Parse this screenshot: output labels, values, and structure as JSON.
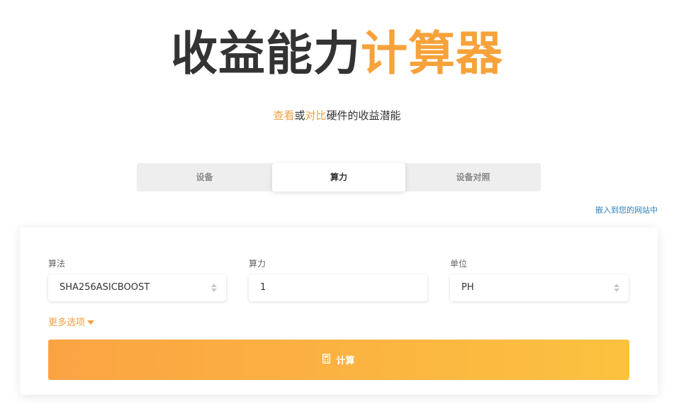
{
  "hero": {
    "title_dark": "收益能力",
    "title_accent": "计算器"
  },
  "subtitle": {
    "part1": "查看",
    "part2": "或",
    "part3": "对比",
    "part4": "硬件的收益潜能"
  },
  "tabs": [
    {
      "label": "设备",
      "active": false
    },
    {
      "label": "算力",
      "active": true
    },
    {
      "label": "设备对照",
      "active": false
    }
  ],
  "embed_link": "嵌入到您的网站中",
  "form": {
    "algorithm": {
      "label": "算法",
      "value": "SHA256ASICBOOST"
    },
    "hashrate": {
      "label": "算力",
      "value": "1"
    },
    "unit": {
      "label": "单位",
      "value": "PH"
    },
    "more_options": "更多选项",
    "calculate_label": "计算"
  },
  "colors": {
    "accent": "#f7a23a",
    "link": "#2a7fc0",
    "button_gradient_start": "#fba343",
    "button_gradient_end": "#fbc23f"
  },
  "icons": {
    "select_arrows": "updown-arrows-icon",
    "more_caret": "caret-down-icon",
    "calculate": "calculator-icon"
  }
}
